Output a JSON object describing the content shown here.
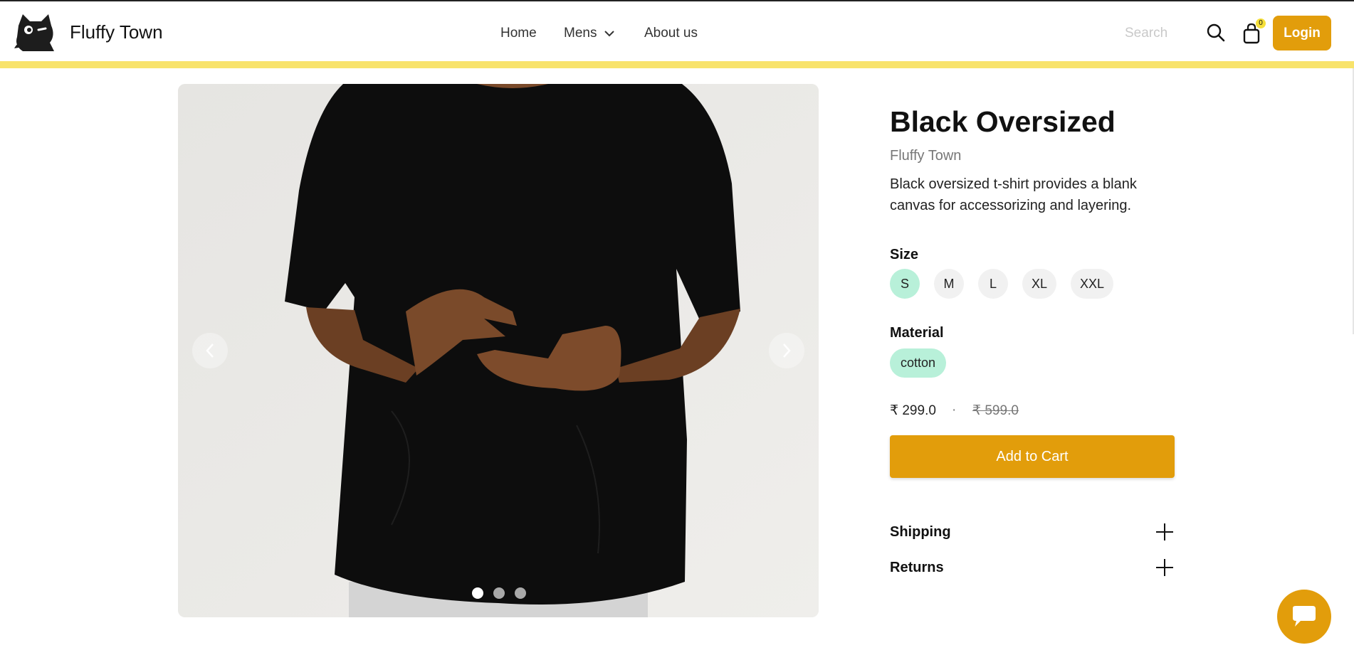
{
  "header": {
    "brand": "Fluffy Town",
    "nav": {
      "home": "Home",
      "mens": "Mens",
      "about": "About us"
    },
    "search_placeholder": "Search",
    "cart_count": "0",
    "login_label": "Login"
  },
  "product": {
    "title": "Black Oversized",
    "vendor": "Fluffy Town",
    "description": "Black oversized t-shirt provides a blank canvas for accessorizing and layering.",
    "size_label": "Size",
    "sizes": [
      "S",
      "M",
      "L",
      "XL",
      "XXL"
    ],
    "selected_size": "S",
    "material_label": "Material",
    "material": "cotton",
    "price": "₹ 299.0",
    "separator": "·",
    "compare_price": "₹ 599.0",
    "add_to_cart_label": "Add to Cart",
    "accordions": {
      "shipping": "Shipping",
      "returns": "Returns"
    }
  },
  "gallery": {
    "image_count": 3,
    "active_index": 0
  },
  "colors": {
    "accent": "#e29d0b",
    "highlight_bar": "#f8e36b",
    "chip_selected": "#b8f0d9",
    "chip_default": "#f1f1f1"
  },
  "icons": [
    "search-icon",
    "bag-icon",
    "chevron-down-icon",
    "chevron-left-icon",
    "chevron-right-icon",
    "plus-icon",
    "chat-icon",
    "cat-logo"
  ]
}
